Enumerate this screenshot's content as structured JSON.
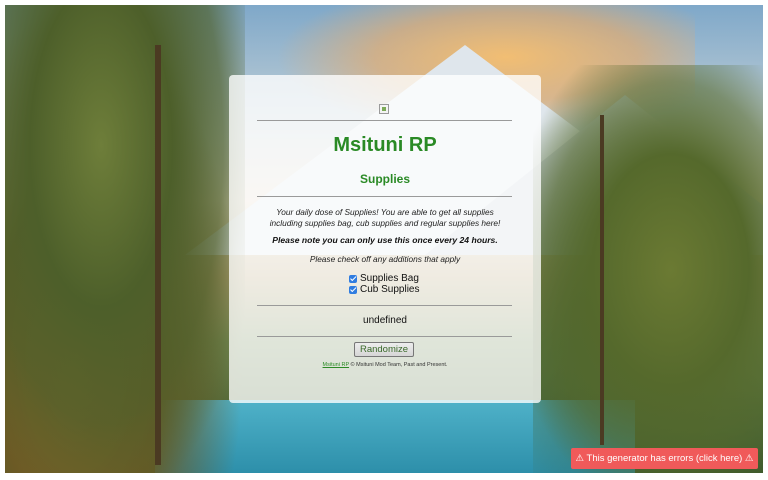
{
  "card": {
    "title": "Msituni RP",
    "subtitle": "Supplies",
    "description": "Your daily dose of Supplies! You are able to get all supplies including supplies bag, cub supplies and regular supplies here!",
    "note": "Please note you can only use this once every 24 hours.",
    "prompt": "Please check off any additions that apply",
    "options": [
      {
        "label": "Supplies Bag",
        "checked": true
      },
      {
        "label": "Cub Supplies",
        "checked": true
      }
    ],
    "result": "undefined",
    "button_label": "Randomize",
    "footer": {
      "link_text": "Msituni RP",
      "text": " © Msituni Mod Team, Past and Present."
    }
  },
  "error_banner": "⚠ This generator has errors (click here) ⚠",
  "colors": {
    "accent": "#2a8a25",
    "error": "#f05a5a",
    "checkbox": "#2f7ce0"
  }
}
